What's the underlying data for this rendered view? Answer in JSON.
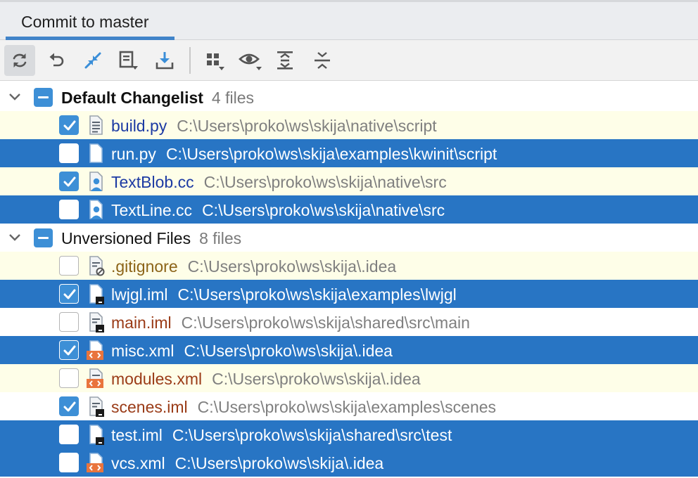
{
  "tab": {
    "label": "Commit to master"
  },
  "toolbar": {
    "buttons": [
      {
        "name": "refresh-icon",
        "active": true
      },
      {
        "name": "rollback-icon"
      },
      {
        "name": "show-diff-icon"
      },
      {
        "name": "move-to-changelist-icon"
      },
      {
        "name": "update-icon"
      },
      {
        "name": "group-by-icon"
      },
      {
        "name": "view-options-icon"
      },
      {
        "name": "expand-all-icon"
      },
      {
        "name": "collapse-all-icon"
      }
    ]
  },
  "groups": [
    {
      "name": "Default Changelist",
      "count": "4 files",
      "bold": true,
      "files": [
        {
          "name": "build.py",
          "path": "C:\\Users\\proko\\ws\\skija\\native\\script",
          "checked": true,
          "selected": false,
          "state": "modified",
          "icon": "text-file-icon"
        },
        {
          "name": "run.py",
          "path": "C:\\Users\\proko\\ws\\skija\\examples\\kwinit\\script",
          "checked": false,
          "selected": true,
          "state": "modified",
          "icon": "text-file-icon"
        },
        {
          "name": "TextBlob.cc",
          "path": "C:\\Users\\proko\\ws\\skija\\native\\src",
          "checked": true,
          "selected": false,
          "state": "modified",
          "icon": "user-file-icon"
        },
        {
          "name": "TextLine.cc",
          "path": "C:\\Users\\proko\\ws\\skija\\native\\src",
          "checked": false,
          "selected": true,
          "state": "modified",
          "icon": "user-file-icon"
        }
      ]
    },
    {
      "name": "Unversioned Files",
      "count": "8 files",
      "bold": false,
      "files": [
        {
          "name": ".gitignore",
          "path": "C:\\Users\\proko\\ws\\skija\\.idea",
          "checked": false,
          "selected": false,
          "state": "ignored",
          "icon": "ignore-file-icon"
        },
        {
          "name": "lwjgl.iml",
          "path": "C:\\Users\\proko\\ws\\skija\\examples\\lwjgl",
          "checked": true,
          "selected": true,
          "state": "unversioned",
          "icon": "module-file-icon"
        },
        {
          "name": "main.iml",
          "path": "C:\\Users\\proko\\ws\\skija\\shared\\src\\main",
          "checked": false,
          "selected": false,
          "state": "unversioned",
          "icon": "module-file-icon"
        },
        {
          "name": "misc.xml",
          "path": "C:\\Users\\proko\\ws\\skija\\.idea",
          "checked": true,
          "selected": true,
          "state": "unversioned",
          "icon": "xml-file-icon"
        },
        {
          "name": "modules.xml",
          "path": "C:\\Users\\proko\\ws\\skija\\.idea",
          "checked": false,
          "selected": false,
          "state": "unversioned",
          "icon": "xml-file-icon"
        },
        {
          "name": "scenes.iml",
          "path": "C:\\Users\\proko\\ws\\skija\\examples\\scenes",
          "checked": true,
          "selected": false,
          "state": "unversioned",
          "icon": "module-file-icon"
        },
        {
          "name": "test.iml",
          "path": "C:\\Users\\proko\\ws\\skija\\shared\\src\\test",
          "checked": false,
          "selected": true,
          "state": "unversioned",
          "icon": "module-file-icon"
        },
        {
          "name": "vcs.xml",
          "path": "C:\\Users\\proko\\ws\\skija\\.idea",
          "checked": false,
          "selected": true,
          "state": "unversioned",
          "icon": "xml-file-icon"
        }
      ]
    }
  ],
  "colors": {
    "selection": "#2875c4",
    "highlight": "#fefee8",
    "modified_text": "#1c3aa3",
    "unversioned_text": "#9a3b17",
    "ignored_text": "#8c6418",
    "path_text": "#7f7f7f",
    "accent": "#3d8fd6"
  }
}
